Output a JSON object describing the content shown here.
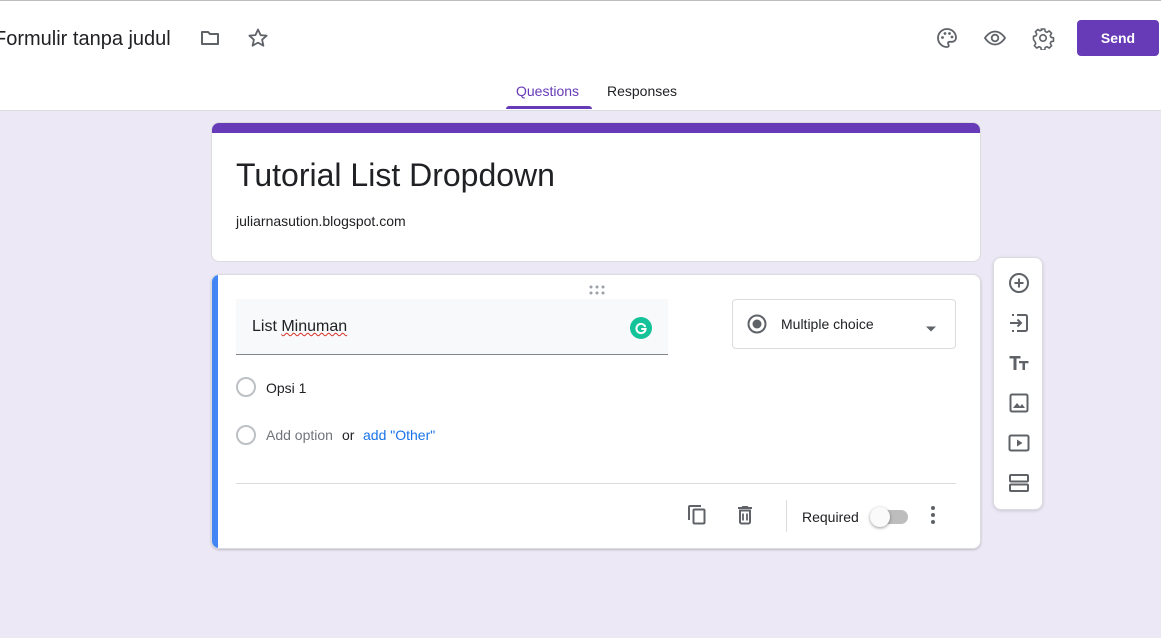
{
  "header": {
    "doc_title": "Formulir tanpa judul",
    "send_label": "Send",
    "icons": [
      "folder-icon",
      "star-icon",
      "palette-icon",
      "eye-icon",
      "gear-icon"
    ]
  },
  "tabs": [
    {
      "label": "Questions",
      "active": true
    },
    {
      "label": "Responses",
      "active": false
    }
  ],
  "form": {
    "title": "Tutorial List Dropdown",
    "description": "juliarnasution.blogspot.com"
  },
  "question": {
    "title_prefix": "List ",
    "title_misspelled": "Minuman",
    "type": "Multiple choice",
    "options": [
      "Opsi 1"
    ],
    "add_option": "Add option",
    "or_text": "or",
    "add_other": "add \"Other\"",
    "required_label": "Required",
    "required": false
  },
  "toolbar": {
    "items": [
      "add-question-icon",
      "import-questions-icon",
      "add-title-icon",
      "add-image-icon",
      "add-video-icon",
      "add-section-icon"
    ]
  },
  "colors": {
    "accent": "#673ab7",
    "background": "#ede8f6",
    "question_accent": "#4285f4",
    "link": "#1a73e8",
    "grammarly": "#15c39a"
  }
}
